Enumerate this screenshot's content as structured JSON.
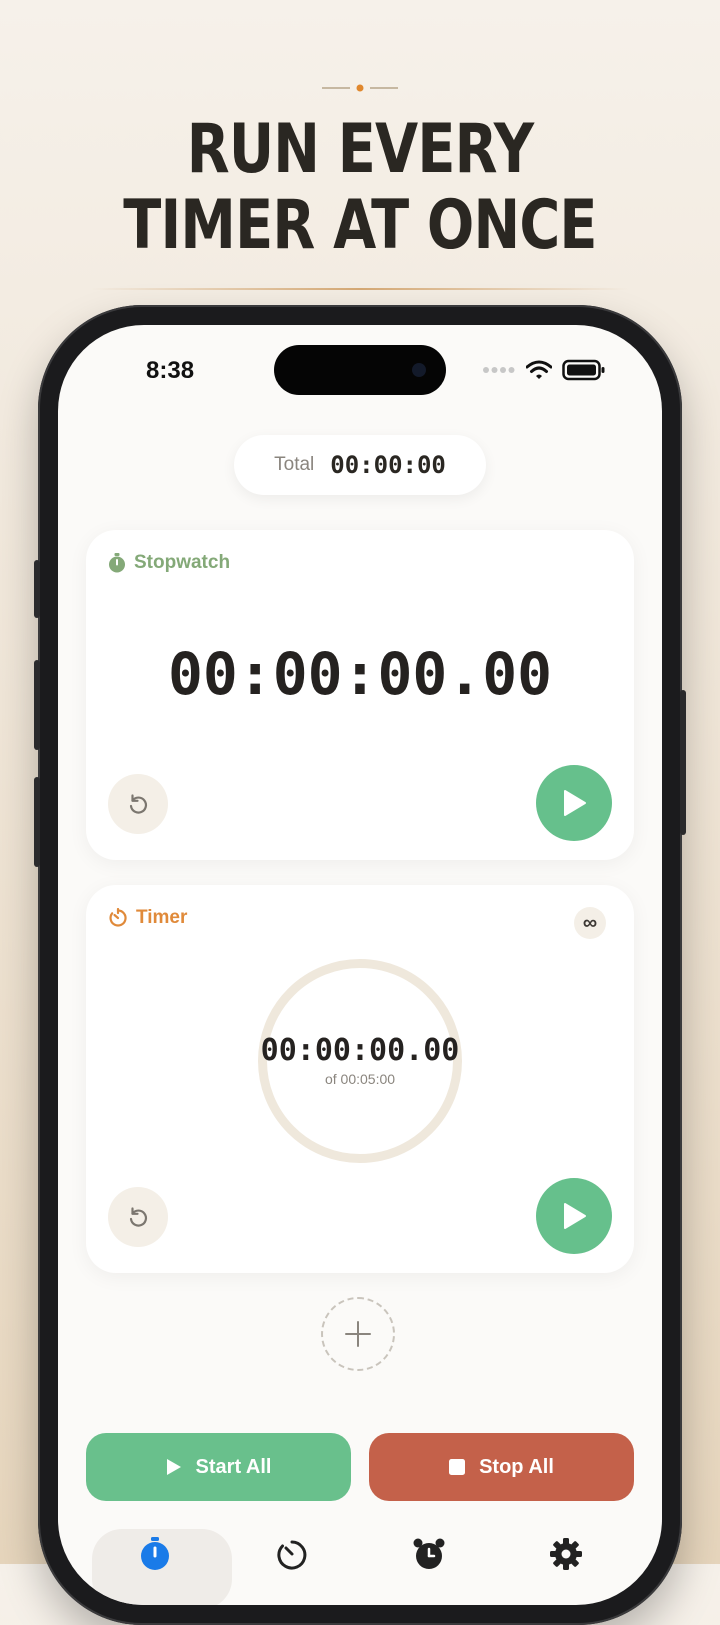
{
  "headline": {
    "line1": "RUN EVERY",
    "line2": "TIMER AT ONCE"
  },
  "status_bar": {
    "time": "8:38",
    "icons": [
      "signal-dots-icon",
      "wifi-icon",
      "battery-icon"
    ]
  },
  "total": {
    "label": "Total",
    "value": "00:00:00"
  },
  "stopwatch": {
    "title": "Stopwatch",
    "display": "00:00:00.00",
    "icon": "stopwatch-icon",
    "controls": [
      "reset-icon",
      "play-icon"
    ]
  },
  "timer": {
    "title": "Timer",
    "display": "00:00:00.00",
    "subtitle": "of 00:05:00",
    "icon": "timer-icon",
    "progress": 0,
    "loop_symbol": "∞",
    "controls": [
      "reset-icon",
      "play-icon"
    ]
  },
  "actions": {
    "start_all": "Start All",
    "stop_all": "Stop All"
  },
  "tabs": [
    {
      "icon": "stopwatch-tab-icon",
      "active": true
    },
    {
      "icon": "timer-tab-icon",
      "active": false
    },
    {
      "icon": "alarm-tab-icon",
      "active": false
    },
    {
      "icon": "settings-tab-icon",
      "active": false
    }
  ],
  "colors": {
    "accent_green": "#66c08c",
    "stop_red": "#c4614a",
    "stopwatch_label": "#84a978",
    "timer_label": "#e08a3a",
    "active_tab_blue": "#1a7be8"
  }
}
